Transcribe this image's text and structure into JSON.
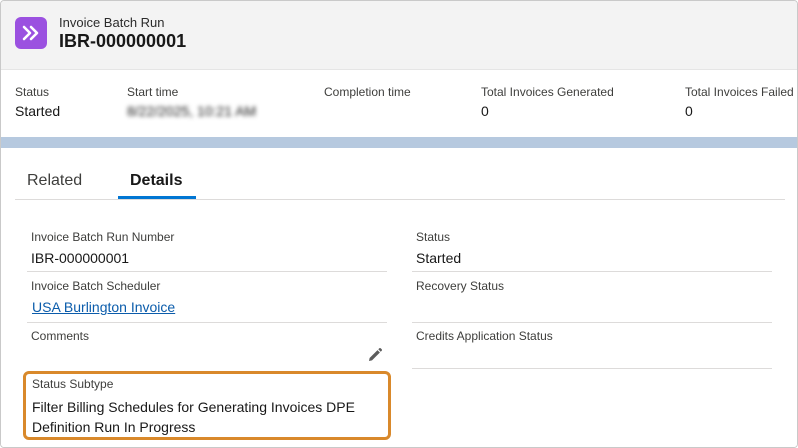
{
  "header": {
    "object_type": "Invoice Batch Run",
    "record_name": "IBR-000000001",
    "icon": "chevrons-right-icon",
    "icon_color": "#9b51e0"
  },
  "highlights": [
    {
      "label": "Status",
      "value": "Started"
    },
    {
      "label": "Start time",
      "value": "8/22/2025, 10:21 AM",
      "blurred": true
    },
    {
      "label": "Completion time",
      "value": ""
    },
    {
      "label": "Total Invoices Generated",
      "value": "0"
    },
    {
      "label": "Total Invoices Failed",
      "value": "0"
    }
  ],
  "tabs": [
    {
      "label": "Related",
      "active": false
    },
    {
      "label": "Details",
      "active": true
    }
  ],
  "details": {
    "left": [
      {
        "label": "Invoice Batch Run Number",
        "value": "IBR-000000001"
      },
      {
        "label": "Invoice Batch Scheduler",
        "value": "USA Burlington Invoice",
        "link": true
      },
      {
        "label": "Comments",
        "value": "",
        "editable": true
      }
    ],
    "right": [
      {
        "label": "Status",
        "value": "Started"
      },
      {
        "label": "Recovery Status",
        "value": ""
      },
      {
        "label": "Credits Application Status",
        "value": ""
      }
    ],
    "status_subtype": {
      "label": "Status Subtype",
      "value": "Filter Billing Schedules for Generating Invoices DPE Definition Run In Progress"
    }
  },
  "colors": {
    "accent": "#0176d3",
    "link": "#0b5cab",
    "highlight_border": "#d9892b",
    "band": "#b6c9df"
  }
}
